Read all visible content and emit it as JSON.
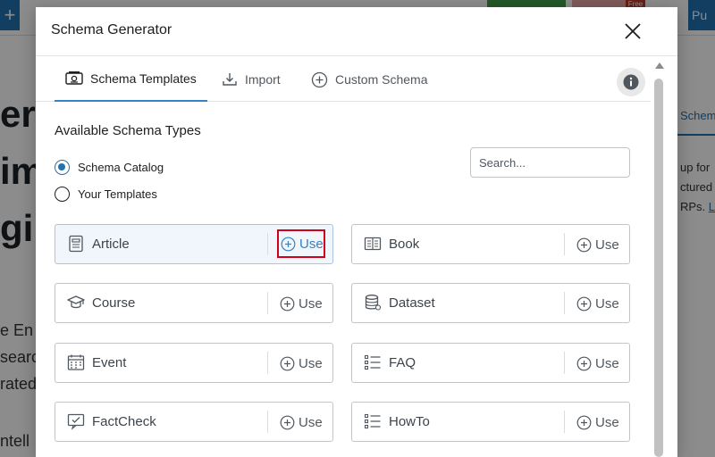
{
  "background": {
    "plus_label": "+",
    "free_badge": "Free",
    "publish_label": "Pu",
    "hero_lines": [
      "er",
      "im",
      "gi"
    ],
    "para_lines": [
      "e En",
      "searc",
      "rated"
    ],
    "para_extra": "ntell",
    "right_tab": "Schem",
    "right_lines": [
      "up for",
      "ctured",
      "RPs."
    ],
    "right_link": "Le"
  },
  "modal": {
    "title": "Schema Generator",
    "tabs": [
      {
        "label": "Schema Templates",
        "active": true,
        "icon": "schema-templates-icon"
      },
      {
        "label": "Import",
        "active": false,
        "icon": "import-icon"
      },
      {
        "label": "Custom Schema",
        "active": false,
        "icon": "plus-circle-icon"
      }
    ],
    "section_title": "Available Schema Types",
    "radios": [
      {
        "label": "Schema Catalog",
        "checked": true
      },
      {
        "label": "Your Templates",
        "checked": false
      }
    ],
    "search_placeholder": "Search...",
    "cards": [
      {
        "label": "Article",
        "icon": "article-icon",
        "use_label": "Use"
      },
      {
        "label": "Book",
        "icon": "book-icon",
        "use_label": "Use"
      },
      {
        "label": "Course",
        "icon": "graduation-cap-icon",
        "use_label": "Use"
      },
      {
        "label": "Dataset",
        "icon": "database-icon",
        "use_label": "Use"
      },
      {
        "label": "Event",
        "icon": "calendar-icon",
        "use_label": "Use"
      },
      {
        "label": "FAQ",
        "icon": "list-icon",
        "use_label": "Use"
      },
      {
        "label": "FactCheck",
        "icon": "fact-check-icon",
        "use_label": "Use"
      },
      {
        "label": "HowTo",
        "icon": "list-icon",
        "use_label": "Use"
      }
    ],
    "accent_color": "#3582c4",
    "highlight_color": "#d0021b"
  }
}
